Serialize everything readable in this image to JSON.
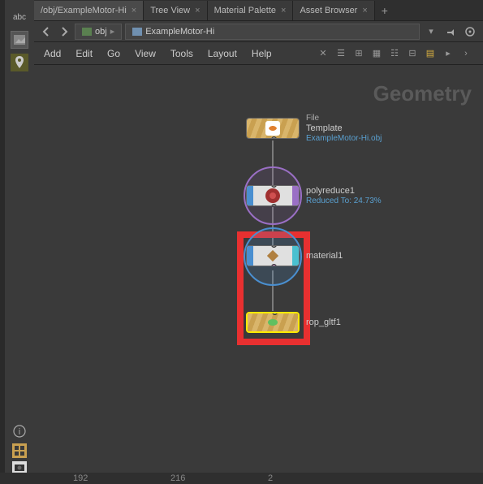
{
  "tabs": [
    {
      "label": "/obj/ExampleMotor-Hi",
      "active": true
    },
    {
      "label": "Tree View",
      "active": false
    },
    {
      "label": "Material Palette",
      "active": false
    },
    {
      "label": "Asset Browser",
      "active": false
    }
  ],
  "path": {
    "level1": "obj",
    "level2": "ExampleMotor-Hi"
  },
  "menu": {
    "add": "Add",
    "edit": "Edit",
    "go": "Go",
    "view": "View",
    "tools": "Tools",
    "layout": "Layout",
    "help": "Help"
  },
  "context_label": "Geometry",
  "nodes": {
    "file": {
      "type": "File",
      "title": "Template",
      "sub": "ExampleMotor-Hi.obj"
    },
    "polyreduce": {
      "title": "polyreduce1",
      "sub": "Reduced To: 24.73%"
    },
    "material": {
      "title": "material1"
    },
    "rop": {
      "title": "rop_gltf1"
    }
  },
  "ruler": {
    "t1": "192",
    "t2": "216",
    "t3": "2"
  },
  "left_tools": {
    "abc": "abc"
  }
}
